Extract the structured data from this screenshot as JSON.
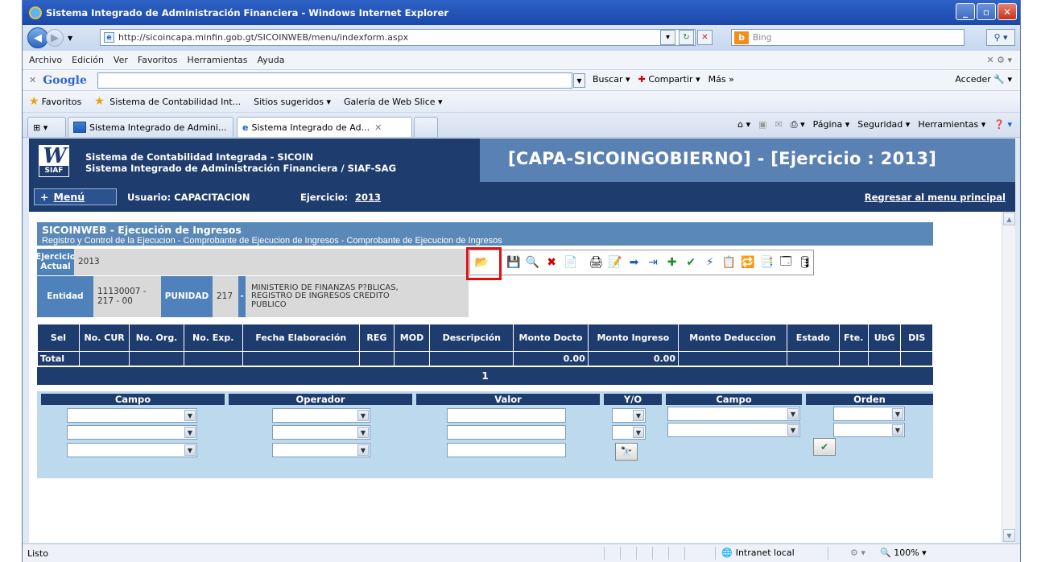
{
  "window": {
    "title": "Sistema Integrado de Administración Financiera - Windows Internet Explorer",
    "minimize": "_",
    "maximize": "▫",
    "close": "✕"
  },
  "address": {
    "url": "http://sicoincapa.minfin.gob.gt/SICOINWEB/menu/indexform.aspx",
    "search_placeholder": "Bing"
  },
  "menubar": {
    "items": [
      "Archivo",
      "Edición",
      "Ver",
      "Favoritos",
      "Herramientas",
      "Ayuda"
    ]
  },
  "google_toolbar": {
    "logo": "Google",
    "buscar": "Buscar",
    "compartir": "Compartir",
    "mas": "Más »",
    "acceder": "Acceder"
  },
  "favorites": {
    "label": "Favoritos",
    "items": [
      "Sistema de Contabilidad Int...",
      "Sitios sugeridos",
      "Galería de Web Slice"
    ]
  },
  "tabs": {
    "items": [
      "Sistema Integrado de Admini...",
      "Sistema Integrado de Ad..."
    ],
    "tools": [
      "Página",
      "Seguridad",
      "Herramientas"
    ]
  },
  "app": {
    "logo_text": "SIAF",
    "title_line1": "Sistema de Contabilidad Integrada - SICOIN",
    "title_line2": "Sistema Integrado de Administración Financiera / SIAF-SAG",
    "capa_title": "[CAPA-SICOINGOBIERNO] - [Ejercicio : 2013]",
    "menu_label": "Menú",
    "usuario": "Usuario: CAPACITACION",
    "ejercicio_label": "Ejercicio:",
    "ejercicio_value": "2013",
    "regresar": "Regresar al menu principal"
  },
  "panel": {
    "title": "SICOINWEB - Ejecución de Ingresos",
    "subtitle": "Registro y Control de la Ejecucion - Comprobante de Ejecucion de Ingresos - Comprobante de Ejecucion de Ingresos",
    "ejercicio_label": "Ejercicio Actual",
    "ejercicio_value": "2013",
    "entidad_label": "Entidad",
    "entidad_value": "11130007 - 217 - 00",
    "punidad_label": "PUNIDAD",
    "punidad_value": "217",
    "dash": "-",
    "entidad_name": "MINISTERIO DE FINANZAS P?BLICAS, REGISTRO DE INGRESOS CREDITO PUBLICO"
  },
  "grid": {
    "headers": [
      "Sel",
      "No. CUR",
      "No. Org.",
      "No. Exp.",
      "Fecha Elaboración",
      "REG",
      "MOD",
      "Descripción",
      "Monto Docto",
      "Monto Ingreso",
      "Monto Deduccion",
      "Estado",
      "Fte.",
      "UbG",
      "DIS"
    ],
    "total_label": "Total",
    "monto_docto_total": "0.00",
    "monto_ingreso_total": "0.00",
    "page": "1"
  },
  "filter": {
    "headers": [
      "Campo",
      "Operador",
      "Valor",
      "Y/O",
      "Campo",
      "Orden"
    ]
  },
  "status": {
    "text": "Listo",
    "zone": "Intranet local",
    "zoom": "100%"
  }
}
